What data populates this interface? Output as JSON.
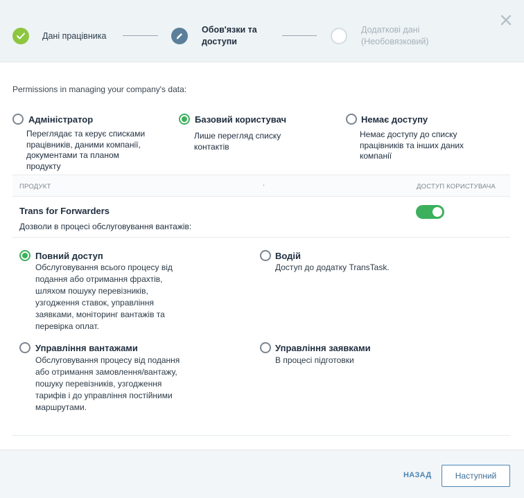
{
  "stepper": {
    "steps": [
      {
        "label": "Дані працівника",
        "status": "done"
      },
      {
        "label_line1": "Обов'язки та",
        "label_line2": "доступи",
        "status": "active"
      },
      {
        "label_line1": "Додаткові дані",
        "label_line2": "(Необовязковий)",
        "status": "pending"
      }
    ],
    "close_icon": "close-icon"
  },
  "intro_text": "Permissions in managing your company's data:",
  "company_access": {
    "options": [
      {
        "title": "Адміністратор",
        "desc": [
          "Переглядає та керує списками",
          "працівників, даними компанії,",
          "документами та планом",
          "продукту"
        ],
        "selected": false
      },
      {
        "title": "Базовий користувач",
        "desc": [
          "Лише перегляд списку",
          "контактів"
        ],
        "selected": true
      },
      {
        "title": "Немає доступу",
        "desc": [
          "Немає доступу до списку",
          "працівників та інших даних",
          "компанії"
        ],
        "selected": false
      }
    ]
  },
  "table": {
    "col_product": "ПРОДУКТ",
    "col_dot": ".",
    "col_access": "ДОСТУП КОРИСТУВАЧА"
  },
  "product": {
    "name": "Trans for Forwarders",
    "subtitle": "Дозволи в процесі обслуговування вантажів:",
    "access_enabled": true
  },
  "permissions": [
    {
      "title": "Повний доступ",
      "desc": [
        "Обслуговування всього процесу від",
        "подання або отримання фрахтів,",
        "шляхом пошуку перевізників,",
        "узгодження ставок, управління",
        "заявками, моніторинг вантажів та",
        "перевірка оплат."
      ],
      "selected": true
    },
    {
      "title": "Водій",
      "desc": [
        "Доступ до додатку TransTask."
      ],
      "selected": false
    },
    {
      "title": "Управління вантажами",
      "desc": [
        "Обслуговування процесу від подання",
        "або отримання замовлення/вантажу,",
        "пошуку перевізників, узгодження",
        "тарифів і до управління постійними",
        "маршрутами."
      ],
      "selected": false
    },
    {
      "title": "Управління заявками",
      "desc": [
        "В процесі підготовки"
      ],
      "selected": false
    }
  ],
  "footer": {
    "back_label": "НАЗАД",
    "next_label": "Наступний"
  },
  "colors": {
    "accent_green": "#3cb05c",
    "step_done": "#8dc63f",
    "step_active": "#5b7f9a",
    "link_blue": "#4a86b5"
  }
}
